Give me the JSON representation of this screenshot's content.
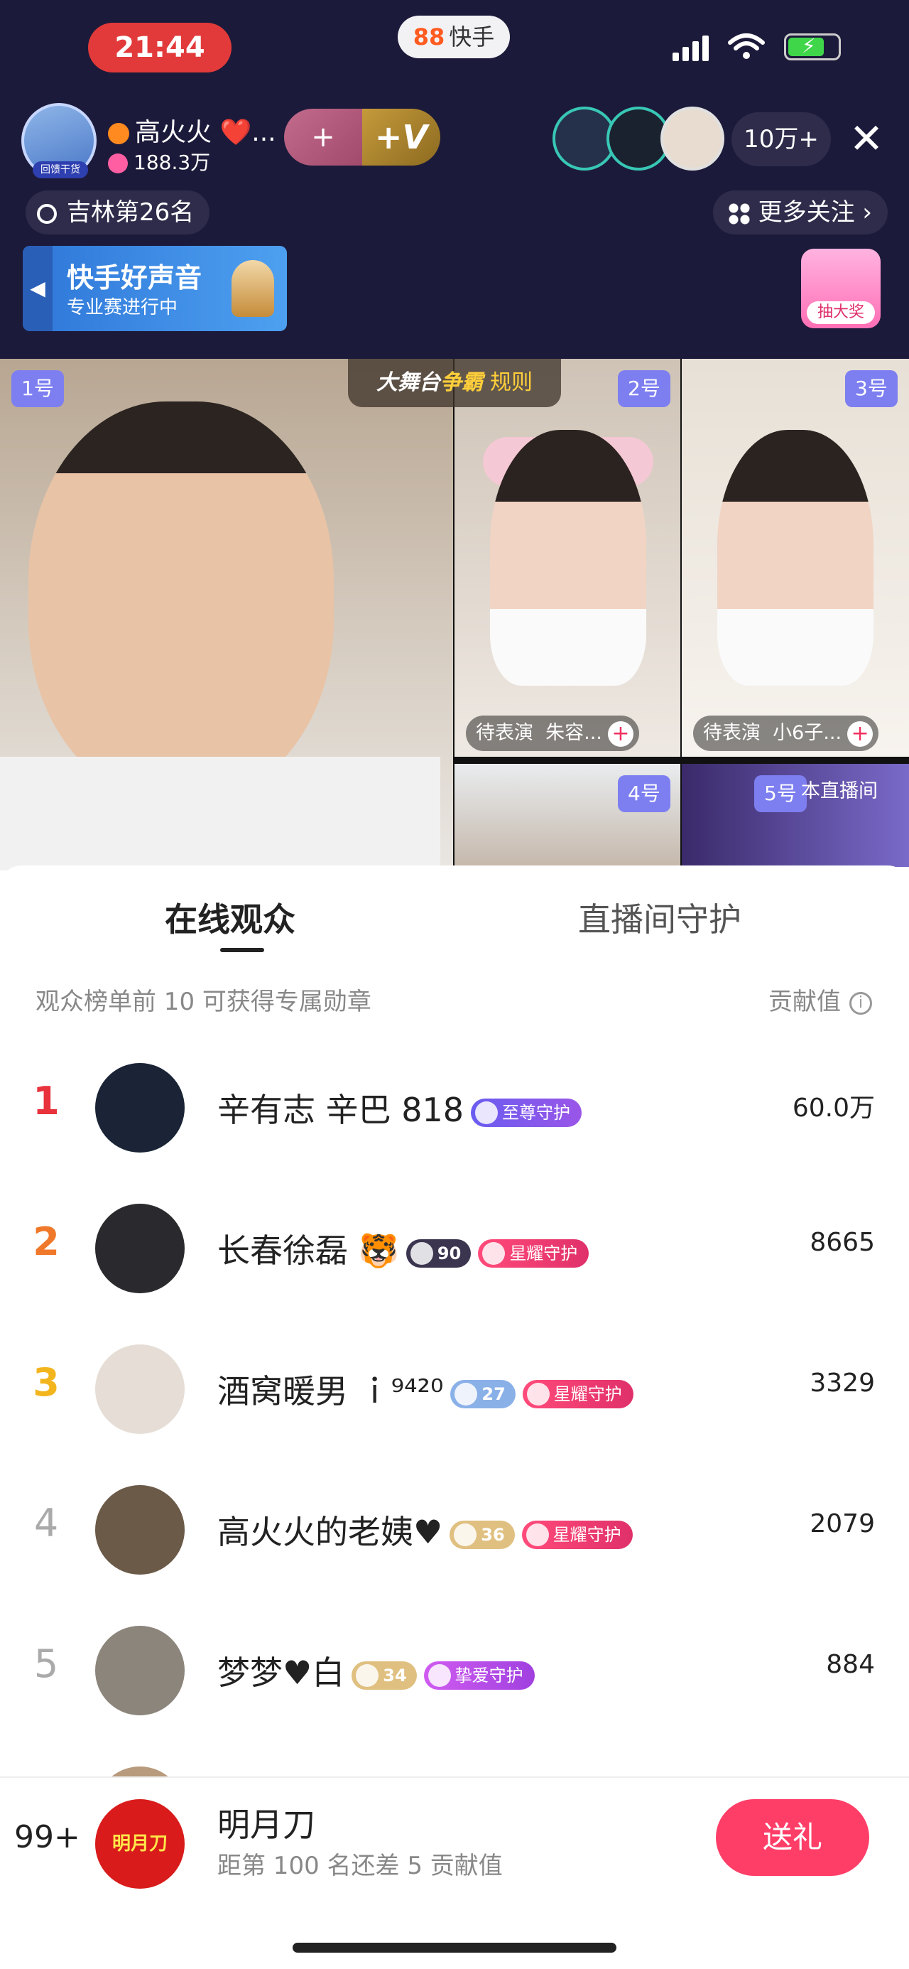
{
  "status_bar": {
    "time": "21:44",
    "app_name": "快手",
    "app_mark": "88"
  },
  "host": {
    "name": "高火火 ❤️...",
    "fans": "188.3万",
    "avatar_tag": "回馈干货"
  },
  "viewers": {
    "count": "10万+"
  },
  "rank_badge": "吉林第26名",
  "more_follow": "更多关注 ›",
  "banner": {
    "title": "快手好声音",
    "subtitle": "专业赛进行中"
  },
  "lottery_label": "抽大奖",
  "stage": {
    "title_a": "大舞台",
    "title_b": "争霸",
    "rule": "规则"
  },
  "slots": {
    "s1": "1号",
    "s2": "2号",
    "s3": "3号",
    "s4": "4号",
    "s5": "5号",
    "s2_status": "待表演",
    "s2_name": "朱容...",
    "s3_status": "待表演",
    "s3_name": "小6子...",
    "this_room": "本直播间"
  },
  "tabs": {
    "online": "在线观众",
    "guard": "直播间守护"
  },
  "hint": "观众榜单前 10 可获得专属勋章",
  "contrib_label": "贡献值",
  "rows": [
    {
      "rank": "1",
      "name": "辛有志 辛巴 818",
      "badge": "至尊守护",
      "value": "60.0万"
    },
    {
      "rank": "2",
      "name": "长春徐磊 🐯",
      "level": "90",
      "badge": "星耀守护",
      "value": "8665"
    },
    {
      "rank": "3",
      "name": "酒窝暖男 ｉ⁹⁴²⁰",
      "level": "27",
      "badge": "星耀守护",
      "value": "3329"
    },
    {
      "rank": "4",
      "name": "高火火的老姨♥",
      "level": "36",
      "badge": "星耀守护",
      "value": "2079"
    },
    {
      "rank": "5",
      "name": "梦梦♥白",
      "level": "34",
      "badge": "挚爱守护",
      "value": "884"
    }
  ],
  "me": {
    "rank": "99+",
    "avatar_text": "明月刀",
    "name": "明月刀",
    "sub": "距第 100 名还差 5 贡献值"
  },
  "gift_button": "送礼",
  "colors": {
    "rank1": "#e8323c",
    "rank2": "#f0782a",
    "rank3": "#f3b51e",
    "rank_other": "#aaaaaa",
    "gift": "#ff3e68"
  }
}
